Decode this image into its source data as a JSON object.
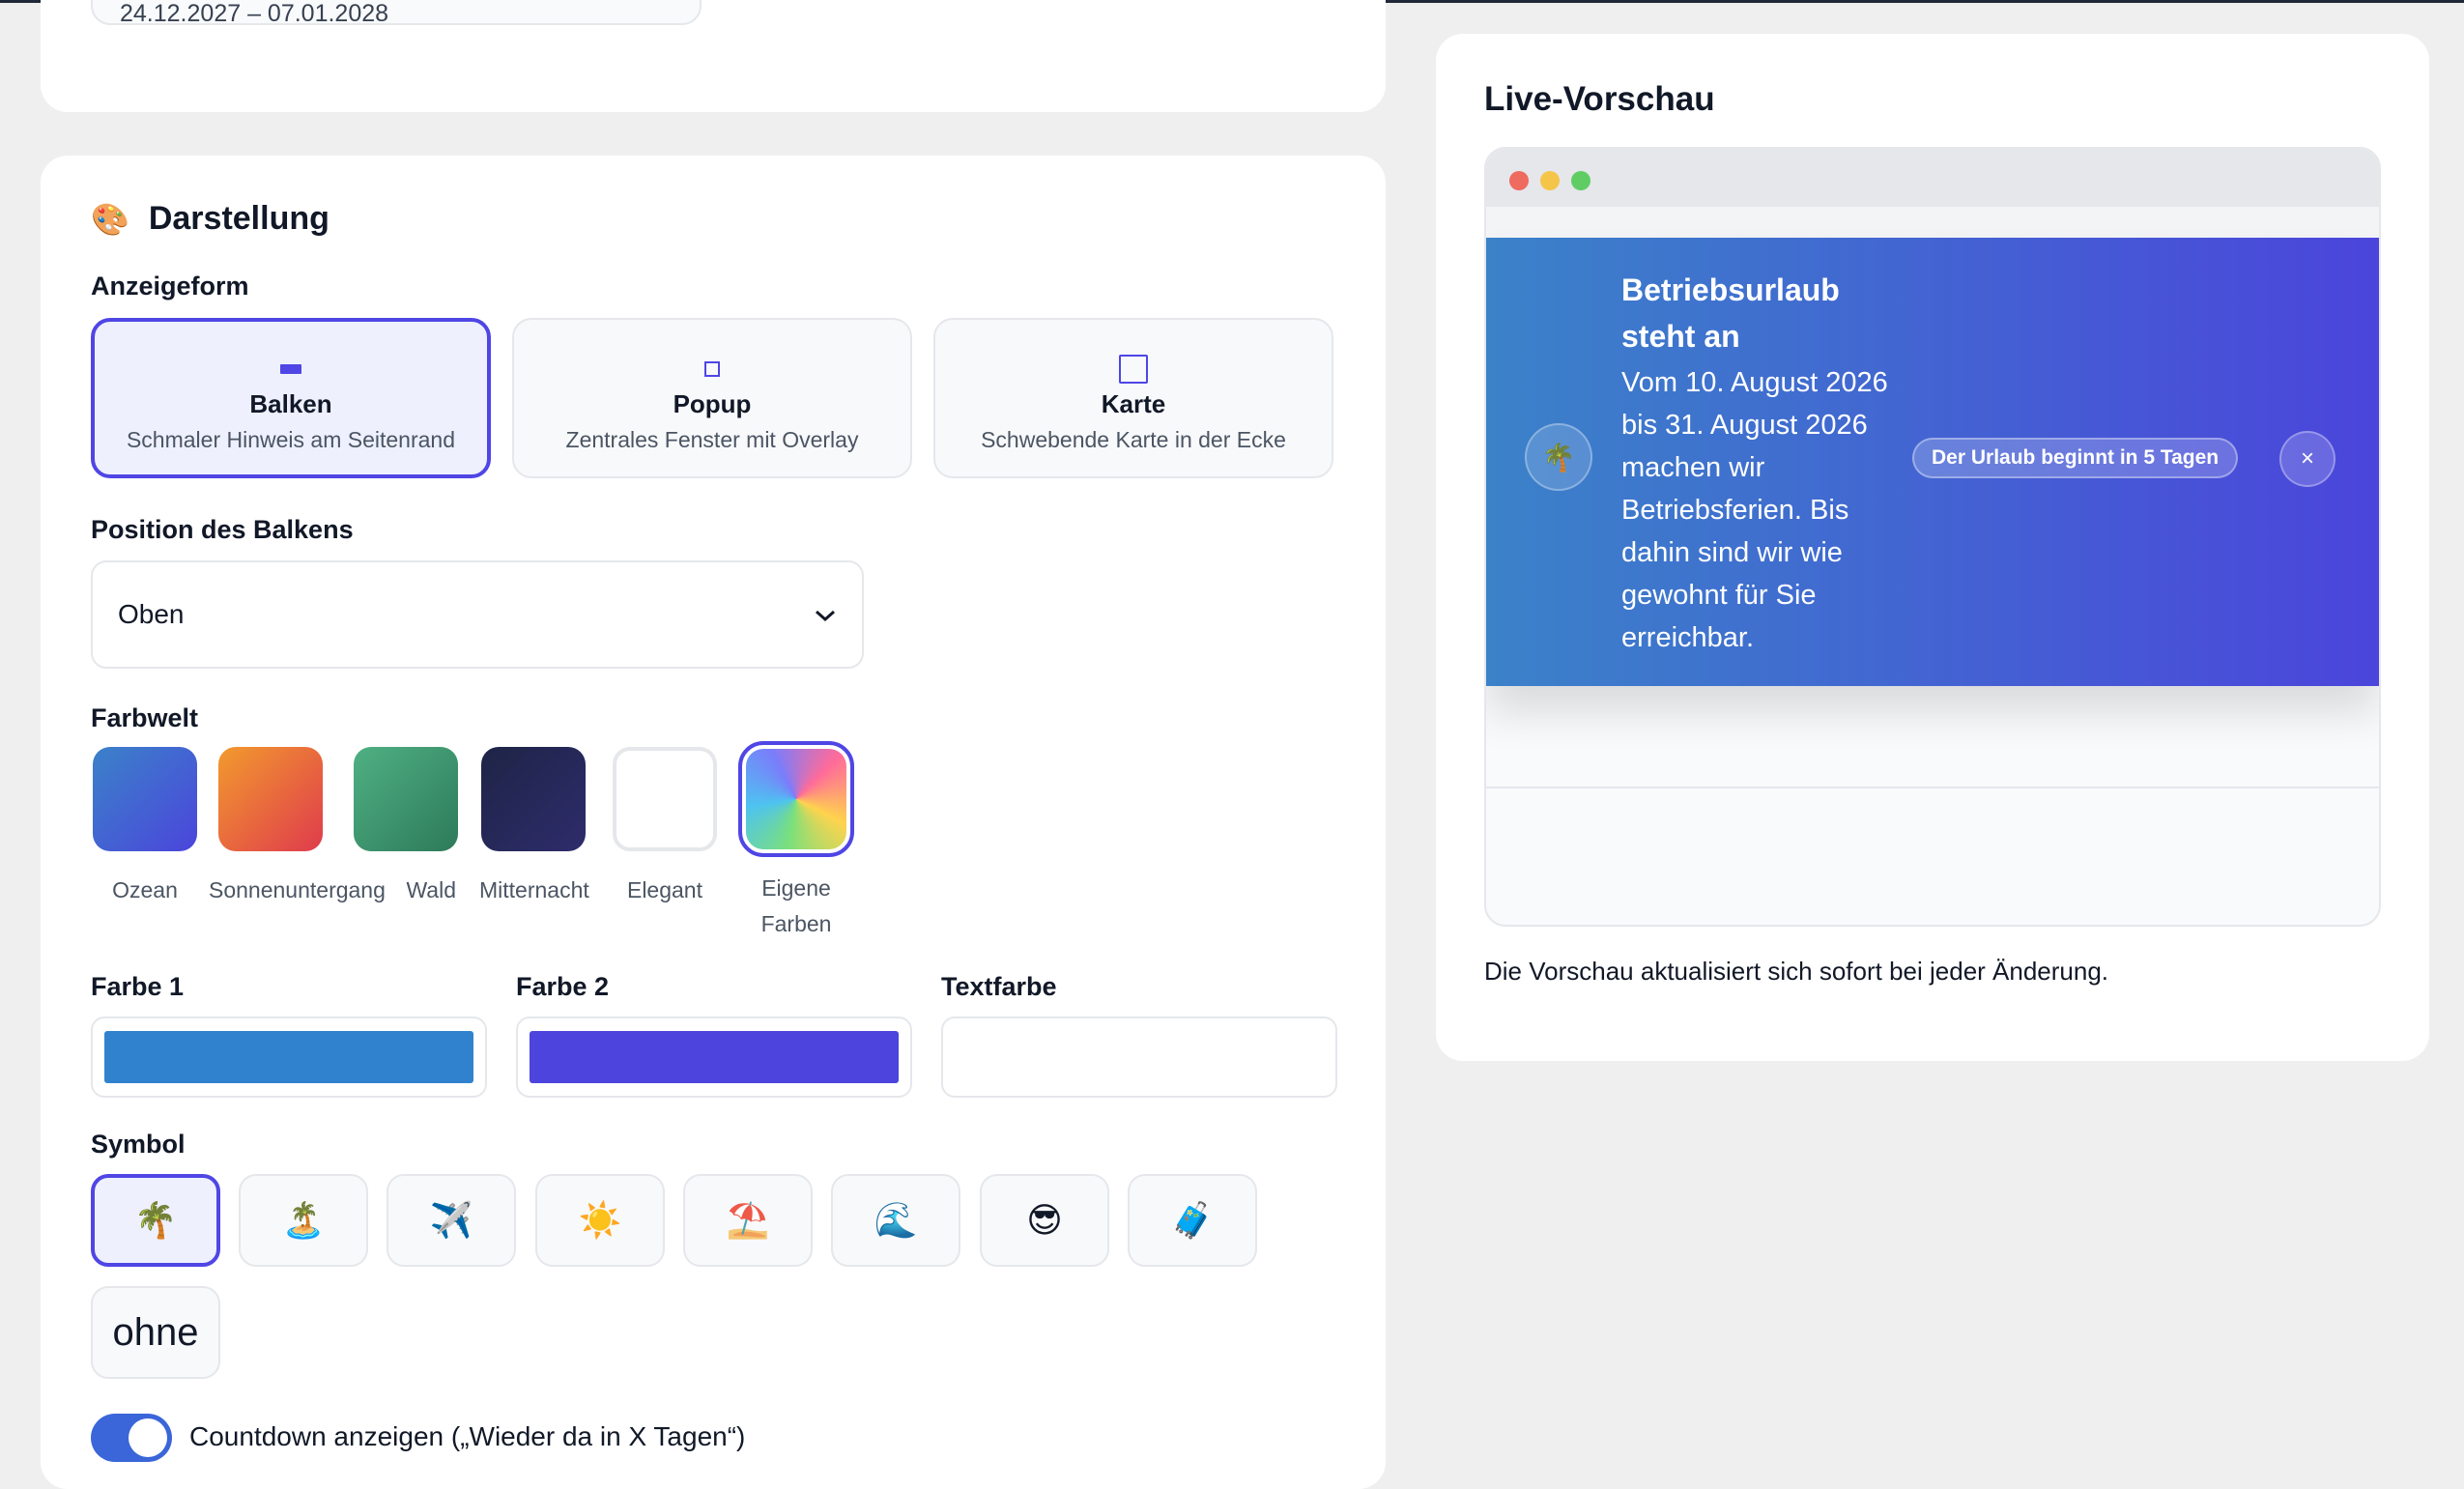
{
  "date_field": {
    "value": "24.12.2027 – 07.01.2028"
  },
  "darstellung": {
    "title": "Darstellung",
    "anzeigeform_label": "Anzeigeform",
    "modes": [
      {
        "title": "Balken",
        "description": "Schmaler Hinweis am Seitenrand",
        "icon": "bar-icon",
        "selected": true
      },
      {
        "title": "Popup",
        "description": "Zentrales Fenster mit Overlay",
        "icon": "popup-icon",
        "selected": false
      },
      {
        "title": "Karte",
        "description": "Schwebende Karte in der Ecke",
        "icon": "card-icon",
        "selected": false
      }
    ],
    "position_label": "Position des Balkens",
    "position_value": "Oben",
    "farbwelt_label": "Farbwelt",
    "farbwelten": [
      {
        "name": "Ozean",
        "colors": [
          "#3b82c9",
          "#4b45db"
        ],
        "selected": false
      },
      {
        "name": "Sonnenuntergang",
        "colors": [
          "#f29a2e",
          "#df3b4c"
        ],
        "selected": false
      },
      {
        "name": "Wald",
        "colors": [
          "#47a77a",
          "#2e7c5c"
        ],
        "selected": false
      },
      {
        "name": "Mitternacht",
        "colors": [
          "#1f2447",
          "#2e2c6b"
        ],
        "selected": false
      },
      {
        "name": "Elegant",
        "colors": [
          "#ffffff",
          "#ffffff"
        ],
        "selected": false
      },
      {
        "name": "Eigene Farben",
        "colors": [
          "rainbow"
        ],
        "selected": true
      }
    ],
    "color_inputs": [
      {
        "label": "Farbe 1",
        "value": "#3182ce"
      },
      {
        "label": "Farbe 2",
        "value": "#4c44dc"
      },
      {
        "label": "Textfarbe",
        "value": "#ffffff"
      }
    ],
    "symbol_label": "Symbol",
    "symbols": [
      {
        "glyph": "🌴",
        "name": "palm-tree-icon",
        "selected": true
      },
      {
        "glyph": "🏝️",
        "name": "island-icon",
        "selected": false
      },
      {
        "glyph": "✈️",
        "name": "airplane-icon",
        "selected": false
      },
      {
        "glyph": "☀️",
        "name": "sun-icon",
        "selected": false
      },
      {
        "glyph": "⛱️",
        "name": "beach-umbrella-icon",
        "selected": false
      },
      {
        "glyph": "🌊",
        "name": "wave-icon",
        "selected": false
      },
      {
        "glyph": "😎",
        "name": "sunglasses-icon",
        "selected": false
      },
      {
        "glyph": "🧳",
        "name": "luggage-icon",
        "selected": false
      },
      {
        "glyph": "ohne",
        "name": "no-symbol",
        "selected": false
      }
    ],
    "countdown_label": "Countdown anzeigen („Wieder da in X Tagen“)",
    "countdown_enabled": true
  },
  "preview": {
    "title": "Live-Vorschau",
    "banner": {
      "heading": "Betriebsurlaub steht an",
      "body": "Vom 10. August 2026 bis 31. August 2026 machen wir Betriebsferien. Bis dahin sind wir wie gewohnt für Sie erreichbar.",
      "icon": "🌴",
      "pill": "Der Urlaub beginnt in 5 Tagen",
      "close": "×"
    },
    "note": "Die Vorschau aktualisiert sich sofort bei jeder Änderung."
  }
}
